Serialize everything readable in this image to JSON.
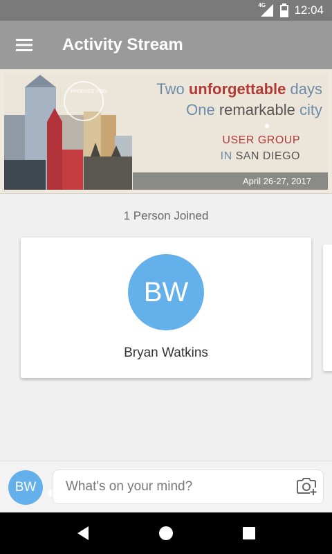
{
  "status_bar": {
    "network": "4G",
    "time": "12:04"
  },
  "app_bar": {
    "title": "Activity Stream"
  },
  "banner": {
    "logo_text": "PRODUCE PRO",
    "line1_prefix": "Two ",
    "line1_highlight": "unforgettable",
    "line1_suffix": " days",
    "line2_prefix": "One ",
    "line2_highlight": "remarkable",
    "line2_suffix": " city",
    "user_group": "USER GROUP",
    "in_word": "IN",
    "city": " SAN DIEGO",
    "dates": "April 26-27, 2017"
  },
  "activity": {
    "joined_label": "1 Person Joined",
    "person": {
      "initials": "BW",
      "name": "Bryan Watkins"
    }
  },
  "composer": {
    "avatar_initials": "BW",
    "placeholder": "What's on your mind?"
  },
  "colors": {
    "avatar": "#64b0ea",
    "app_bar": "#9a9a9a",
    "status_bar": "#7a7a7a",
    "banner_red": "#b23a36",
    "banner_blue": "#6d8aa6"
  },
  "icons": {
    "menu": "hamburger-menu-icon",
    "camera": "camera-add-icon",
    "back": "triangle-back-icon",
    "home": "circle-home-icon",
    "recents": "square-recents-icon"
  }
}
